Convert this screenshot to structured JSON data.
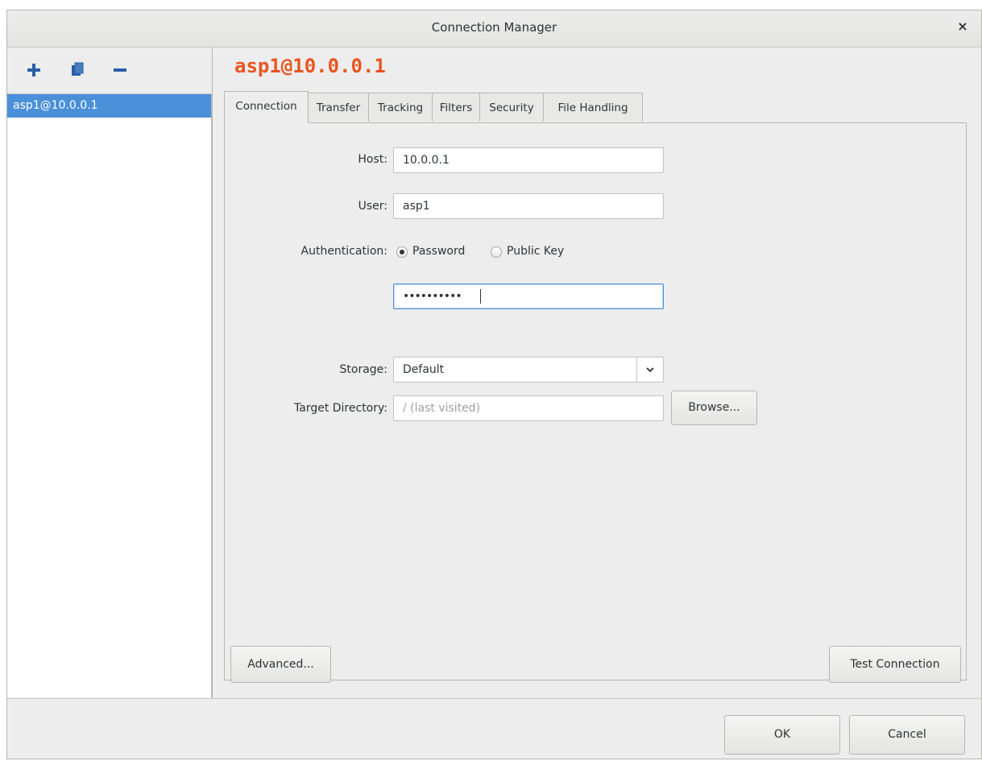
{
  "window": {
    "title": "Connection Manager",
    "close_glyph": "×"
  },
  "toolbar": {
    "add_icon": "plus-icon",
    "copy_icon": "copy-icon",
    "remove_icon": "minus-icon",
    "icon_color": "#2b5fa6"
  },
  "sidebar": {
    "items": [
      {
        "label": "asp1@10.0.0.1",
        "selected": true
      }
    ]
  },
  "profile": {
    "title": "asp1@10.0.0.1",
    "title_color": "#e8551f"
  },
  "tabs": [
    {
      "label": "Connection",
      "active": true
    },
    {
      "label": "Transfer",
      "active": false
    },
    {
      "label": "Tracking",
      "active": false
    },
    {
      "label": "Filters",
      "active": false
    },
    {
      "label": "Security",
      "active": false
    },
    {
      "label": "File Handling",
      "active": false
    }
  ],
  "form": {
    "host": {
      "label": "Host:",
      "value": "10.0.0.1"
    },
    "user": {
      "label": "User:",
      "value": "asp1"
    },
    "authentication": {
      "label": "Authentication:",
      "options": [
        {
          "label": "Password",
          "selected": true
        },
        {
          "label": "Public Key",
          "selected": false
        }
      ]
    },
    "password": {
      "value": "••••••••••"
    },
    "storage": {
      "label": "Storage:",
      "value": "Default"
    },
    "target_directory": {
      "label": "Target Directory:",
      "placeholder": "/ (last visited)",
      "browse_label": "Browse..."
    }
  },
  "pane_buttons": {
    "advanced_label": "Advanced...",
    "test_label": "Test Connection"
  },
  "dialog_buttons": {
    "ok_label": "OK",
    "cancel_label": "Cancel"
  }
}
